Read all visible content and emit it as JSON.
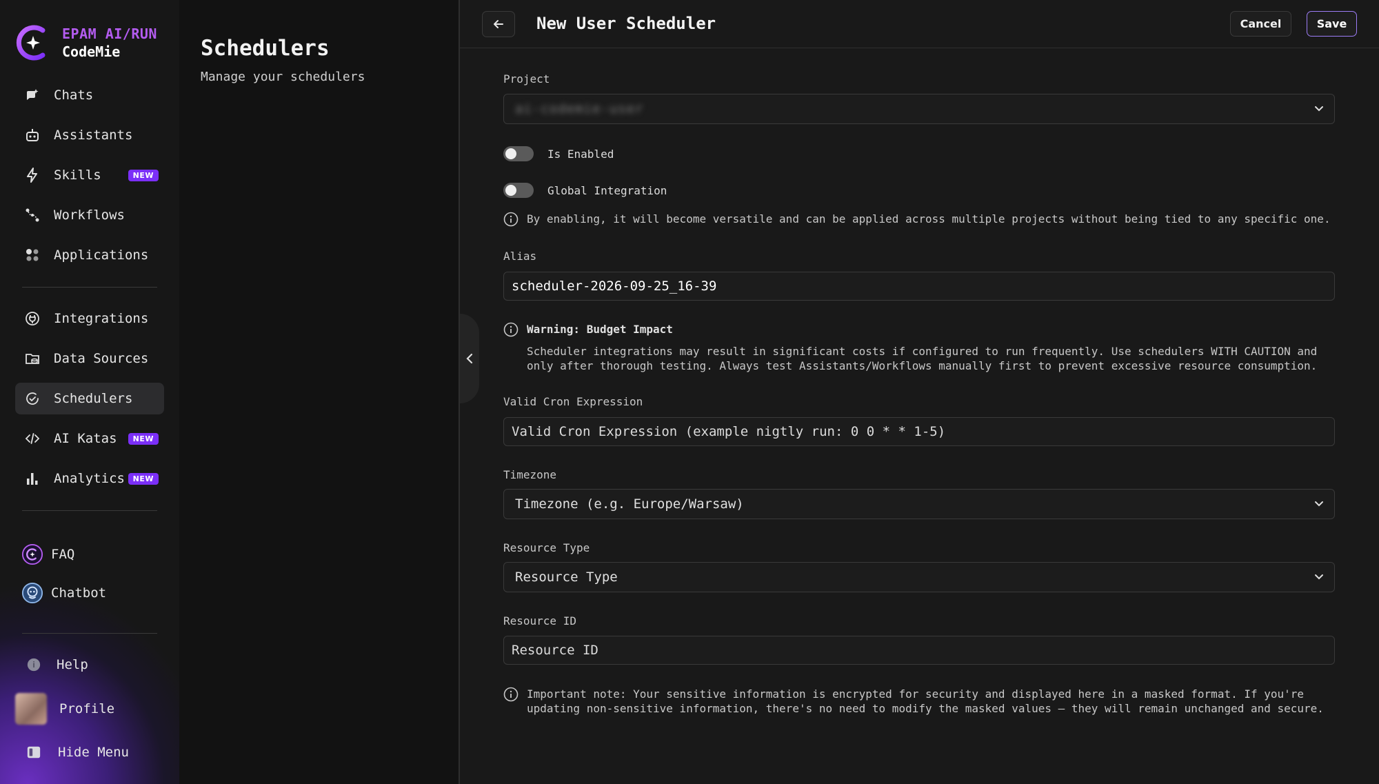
{
  "brand": {
    "line1": "EPAM AI/RUN",
    "line2": "CodeMie"
  },
  "sidebar": {
    "items": [
      {
        "label": "Chats",
        "icon": "chat-icon"
      },
      {
        "label": "Assistants",
        "icon": "robot-icon"
      },
      {
        "label": "Skills",
        "icon": "bolt-icon",
        "badge": "NEW"
      },
      {
        "label": "Workflows",
        "icon": "workflow-icon"
      },
      {
        "label": "Applications",
        "icon": "apps-icon"
      },
      {
        "label": "Integrations",
        "icon": "plug-icon"
      },
      {
        "label": "Data Sources",
        "icon": "database-icon"
      },
      {
        "label": "Schedulers",
        "icon": "scheduler-icon",
        "active": true
      },
      {
        "label": "AI Katas",
        "icon": "code-icon",
        "badge": "NEW"
      },
      {
        "label": "Analytics",
        "icon": "bar-chart-icon",
        "badge": "NEW"
      }
    ],
    "faq": "FAQ",
    "chatbot": "Chatbot",
    "help": "Help",
    "profile": "Profile",
    "hide_menu": "Hide Menu"
  },
  "panel": {
    "title": "Schedulers",
    "subtitle": "Manage your schedulers"
  },
  "header": {
    "title": "New User Scheduler",
    "cancel": "Cancel",
    "save": "Save"
  },
  "form": {
    "project_label": "Project",
    "project_value": "ai-codemie-user",
    "is_enabled_label": "Is Enabled",
    "global_integration_label": "Global Integration",
    "global_note": "By enabling, it will become versatile and can be applied across multiple projects without being tied to any specific one.",
    "alias_label": "Alias",
    "alias_value": "scheduler-2026-09-25_16-39",
    "warning_title": "Warning: Budget Impact",
    "warning_line1": "Scheduler integrations may result in significant costs if configured to run frequently. Use schedulers WITH CAUTION and",
    "warning_line2": "only after thorough testing. Always test Assistants/Workflows manually first to prevent excessive resource consumption.",
    "cron_label": "Valid Cron Expression",
    "cron_placeholder": "Valid Cron Expression (example nigtly run: 0 0 * * 1-5)",
    "timezone_label": "Timezone",
    "timezone_placeholder": "Timezone (e.g. Europe/Warsaw)",
    "resource_type_label": "Resource Type",
    "resource_type_placeholder": "Resource Type",
    "resource_id_label": "Resource ID",
    "resource_id_placeholder": "Resource ID",
    "important_line1": "Important note: Your sensitive information is encrypted for security and displayed here in a masked format. If you're",
    "important_line2": "updating non-sensitive information, there's no need to modify the masked values — they will remain unchanged and secure."
  },
  "colors": {
    "accent": "#7b2ff7",
    "brand": "#b45cf0",
    "save_border": "#9d7df7"
  }
}
